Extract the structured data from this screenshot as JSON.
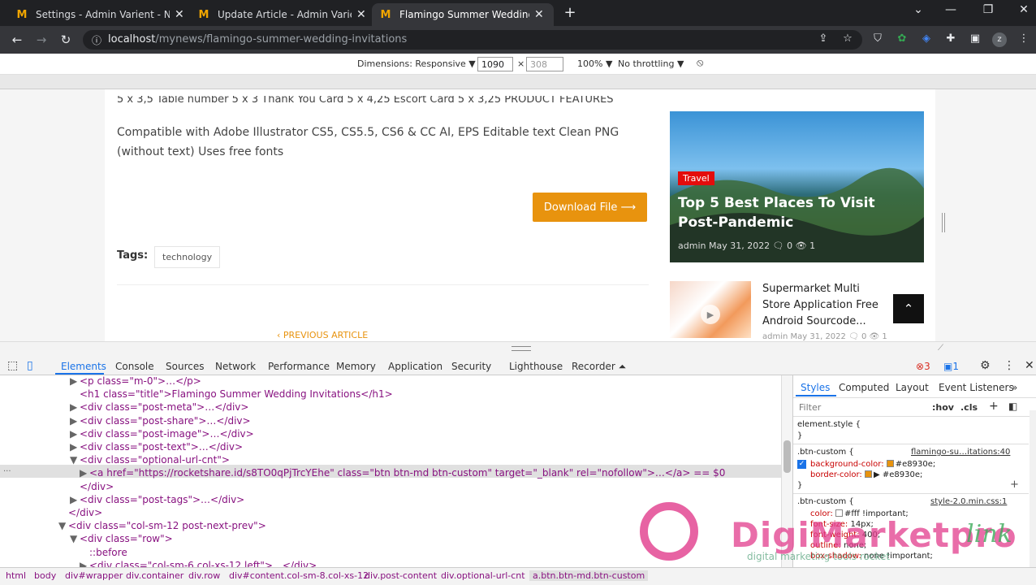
{
  "tabs": [
    {
      "title": "Settings - Admin Varient - News",
      "active": false
    },
    {
      "title": "Update Article - Admin Varient -",
      "active": false
    },
    {
      "title": "Flamingo Summer Wedding Invit",
      "active": true
    }
  ],
  "tab_icon": "M",
  "address": {
    "host": "localhost",
    "path": "/mynews/flamingo-summer-wedding-invitations"
  },
  "device_toolbar": {
    "dimensions_label": "Dimensions: Responsive ▼",
    "width": "1090",
    "x": "×",
    "height": "308",
    "zoom": "100% ▼",
    "throttling": "No throttling ▼"
  },
  "article": {
    "cut_line": "5 x 3,5 Table number 5 x 3 Thank You Card 5 x 4,25 Escort Card 5 x 3,25 PRODUCT FEATURES",
    "paragraph": "Compatible with Adobe Illustrator CS5, CS5.5, CS6 & CC AI, EPS Editable text Clean PNG (without text) Uses free fonts",
    "download_label": "Download File ⟶",
    "tags_label": "Tags:",
    "tag": "technology",
    "prev_label": "‹ PREVIOUS ARTICLE"
  },
  "sidebar": {
    "featured": {
      "category": "Travel",
      "title": "Top 5 Best Places To Visit Post-Pandemic",
      "meta": "admin   May 31, 2022  🗨 0  👁 1"
    },
    "related": {
      "title": "Supermarket Multi Store Application Free Android Sourcode...",
      "meta": "admin   May 31, 2022  🗨 0  👁 1"
    },
    "totop": "⌃"
  },
  "devtools": {
    "tabs": [
      "Elements",
      "Console",
      "Sources",
      "Network",
      "Performance",
      "Memory",
      "Application",
      "Security",
      "Lighthouse",
      "Recorder ⏶"
    ],
    "errors": "3",
    "messages": "1",
    "dom_lines": [
      {
        "indent": 1,
        "arrow": "▶",
        "html": "p",
        "text": "<p class=\"m-0\">…</p>"
      },
      {
        "indent": 1,
        "arrow": "",
        "text": "<h1 class=\"title\">Flamingo Summer Wedding Invitations</h1>"
      },
      {
        "indent": 1,
        "arrow": "▶",
        "text": "<div class=\"post-meta\">…</div>"
      },
      {
        "indent": 1,
        "arrow": "▶",
        "text": "<div class=\"post-share\">…</div>"
      },
      {
        "indent": 1,
        "arrow": "▶",
        "text": "<div class=\"post-image\">…</div>"
      },
      {
        "indent": 1,
        "arrow": "▶",
        "text": "<div class=\"post-text\">…</div>"
      },
      {
        "indent": 1,
        "arrow": "▼",
        "text": "<div class=\"optional-url-cnt\">"
      },
      {
        "indent": 2,
        "arrow": "▶",
        "text": "<a href=\"https://rocketshare.id/s8TO0qPjTrcYEhe\" class=\"btn btn-md btn-custom\" target=\"_blank\" rel=\"nofollow\">…</a> == $0"
      },
      {
        "indent": 1,
        "arrow": "",
        "text": "</div>"
      },
      {
        "indent": 1,
        "arrow": "▶",
        "text": "<div class=\"post-tags\">…</div>"
      },
      {
        "indent": 0,
        "arrow": "",
        "text": "</div>"
      },
      {
        "indent": 0,
        "arrow": "▼",
        "text": "<div class=\"col-sm-12 post-next-prev\">"
      },
      {
        "indent": 1,
        "arrow": "▼",
        "text": "<div class=\"row\">"
      },
      {
        "indent": 2,
        "arrow": "",
        "text": "::before"
      },
      {
        "indent": 2,
        "arrow": "▶",
        "text": "<div class=\"col-sm-6 col-xs-12 left\">…</div>"
      }
    ],
    "styles_tabs": [
      "Styles",
      "Computed",
      "Layout",
      "Event Listeners",
      "»"
    ],
    "filter_placeholder": "Filter",
    "hov": ":hov",
    "cls": ".cls",
    "rules": [
      {
        "selector": "element.style {",
        "source": "",
        "props": []
      },
      {
        "selector": ".btn-custom {",
        "source": "flamingo-su…itations:40",
        "props": [
          {
            "name": "background-color:",
            "value": "#e8930e;"
          },
          {
            "name": "border-color:",
            "value": "▶ #e8930e;"
          }
        ]
      },
      {
        "selector": ".btn-custom {",
        "source": "style-2.0.min.css:1",
        "props": [
          {
            "name": "color:",
            "value": "#fff !important;"
          },
          {
            "name": "font-size:",
            "value": "14px;"
          },
          {
            "name": "font-weight:",
            "value": "400;"
          },
          {
            "name": "outline:",
            "value": "none;"
          },
          {
            "name": "box-shadow:",
            "value": "none !important;"
          }
        ]
      }
    ],
    "breadcrumbs": [
      "html",
      "body",
      "div#wrapper",
      "div.container",
      "div.row",
      "div#content.col-sm-8.col-xs-12",
      "div.post-content",
      "div.optional-url-cnt",
      "a.btn.btn-md.btn-custom"
    ]
  },
  "watermark": {
    "brand": "DigiMarketpro",
    "suffix": "link",
    "tagline": "digital marketing tools rocket"
  },
  "colors": {
    "accent": "#e8930e",
    "devtools_blue": "#1a73e8",
    "chrome_dark": "#202124"
  }
}
